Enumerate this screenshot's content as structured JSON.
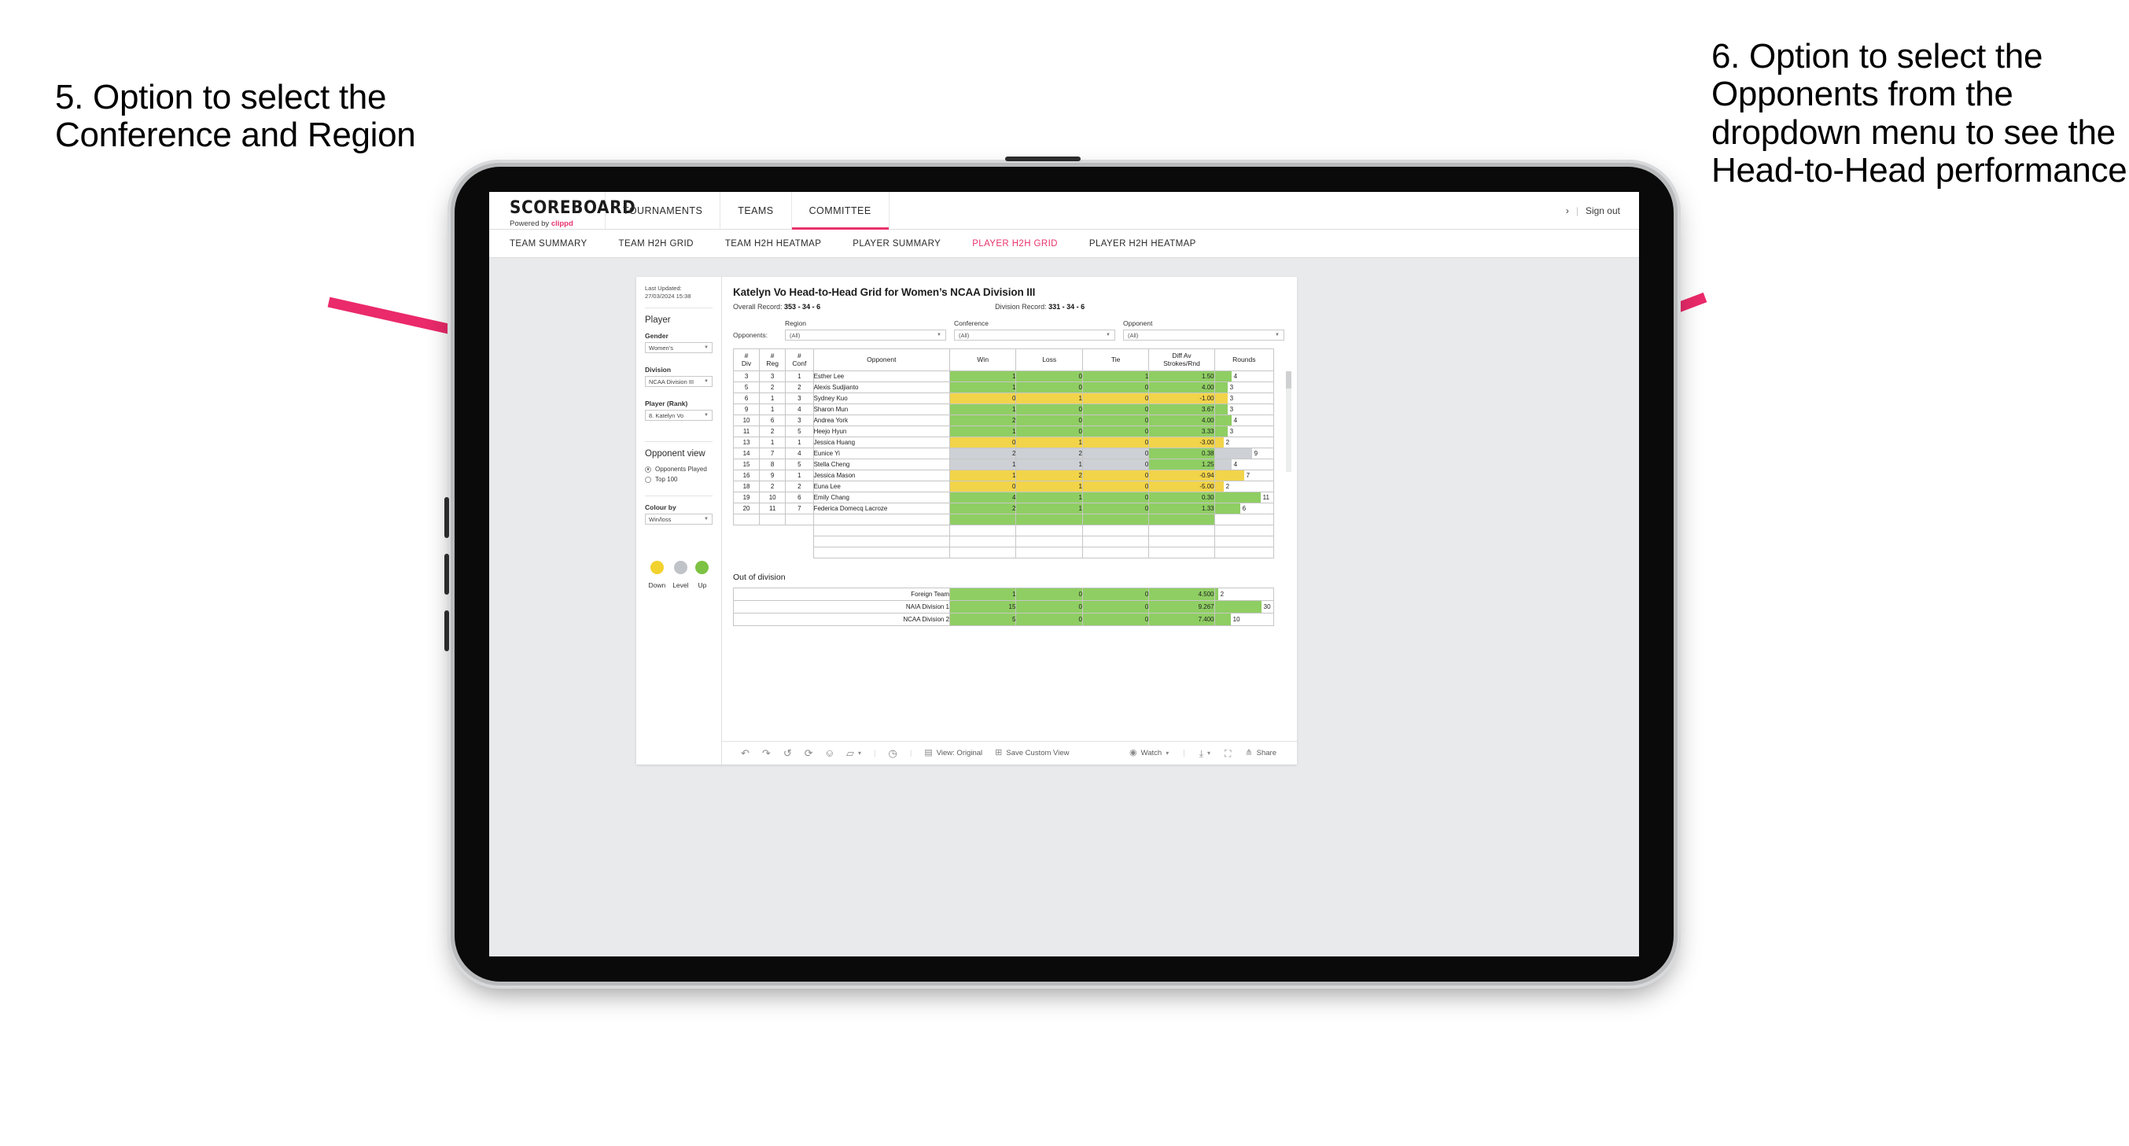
{
  "annotations": {
    "left": "5. Option to select the Conference and Region",
    "right": "6. Option to select the Opponents from the dropdown menu to see the Head-to-Head performance",
    "arrow_color": "#ea2a6a"
  },
  "app": {
    "logo": {
      "word": "SCOREBOARD",
      "powered_prefix": "Powered by ",
      "brand": "clippd"
    },
    "top_nav": [
      {
        "label": "TOURNAMENTS",
        "active": false
      },
      {
        "label": "TEAMS",
        "active": false
      },
      {
        "label": "COMMITTEE",
        "active": true
      }
    ],
    "header_right": {
      "chevron": "›",
      "separator": "|",
      "sign_out": "Sign out"
    },
    "sub_nav": [
      {
        "label": "TEAM SUMMARY",
        "active": false
      },
      {
        "label": "TEAM H2H GRID",
        "active": false
      },
      {
        "label": "TEAM H2H HEATMAP",
        "active": false
      },
      {
        "label": "PLAYER SUMMARY",
        "active": false
      },
      {
        "label": "PLAYER H2H GRID",
        "active": true
      },
      {
        "label": "PLAYER H2H HEATMAP",
        "active": false
      }
    ],
    "accent": "#e8336d"
  },
  "sidebar": {
    "last_updated": "Last Updated: 27/03/2024 15:38",
    "player_heading": "Player",
    "gender": {
      "label": "Gender",
      "value": "Women’s"
    },
    "division": {
      "label": "Division",
      "value": "NCAA Division III"
    },
    "player_rank": {
      "label": "Player (Rank)",
      "value": "8. Katelyn Vo"
    },
    "opponent_view": {
      "heading": "Opponent view",
      "options": [
        {
          "label": "Opponents Played",
          "selected": true
        },
        {
          "label": "Top 100",
          "selected": false
        }
      ]
    },
    "colour_by": {
      "label": "Colour by",
      "value": "Win/loss"
    },
    "legend": [
      {
        "label": "Down",
        "color": "#f2d22e"
      },
      {
        "label": "Level",
        "color": "#c0c3c8"
      },
      {
        "label": "Up",
        "color": "#7dc242"
      }
    ]
  },
  "main": {
    "title": "Katelyn Vo Head-to-Head Grid for Women’s NCAA Division III",
    "overall_record": {
      "label": "Overall Record:",
      "value": "353 -  34 - 6"
    },
    "division_record": {
      "label": "Division Record:",
      "value": "331 -  34 - 6"
    },
    "filters": {
      "prefix": "Opponents:",
      "items": [
        {
          "label": "Region",
          "value": "(All)"
        },
        {
          "label": "Conference",
          "value": "(All)"
        },
        {
          "label": "Opponent",
          "value": "(All)"
        }
      ]
    },
    "out_of_division_title": "Out of division"
  },
  "chart_data": {
    "type": "table",
    "title": "Katelyn Vo Head-to-Head Grid for Women’s NCAA Division III",
    "columns": [
      "# Div",
      "# Reg",
      "# Conf",
      "Opponent",
      "Win",
      "Loss",
      "Tie",
      "Diff Av Strokes/Rnd",
      "Rounds"
    ],
    "column_headers_split": [
      {
        "line1": "#",
        "line2": "Div"
      },
      {
        "line1": "#",
        "line2": "Reg"
      },
      {
        "line1": "#",
        "line2": "Conf"
      },
      {
        "line1": "Opponent",
        "line2": ""
      },
      {
        "line1": "Win",
        "line2": ""
      },
      {
        "line1": "Loss",
        "line2": ""
      },
      {
        "line1": "Tie",
        "line2": ""
      },
      {
        "line1": "Diff Av",
        "line2": "Strokes/Rnd"
      },
      {
        "line1": "Rounds",
        "line2": ""
      }
    ],
    "rounds_max": 12,
    "rows": [
      {
        "div": "3",
        "reg": "3",
        "conf": "1",
        "opponent": "Esther Lee",
        "win": "1",
        "loss": "0",
        "tie": "1",
        "diff": "1.50",
        "rounds": "4",
        "fill": "#8fce63"
      },
      {
        "div": "5",
        "reg": "2",
        "conf": "2",
        "opponent": "Alexis Sudjianto",
        "win": "1",
        "loss": "0",
        "tie": "0",
        "diff": "4.00",
        "rounds": "3",
        "fill": "#8fce63"
      },
      {
        "div": "6",
        "reg": "1",
        "conf": "3",
        "opponent": "Sydney Kuo",
        "win": "0",
        "loss": "1",
        "tie": "0",
        "diff": "-1.00",
        "rounds": "3",
        "fill": "#f2d44a"
      },
      {
        "div": "9",
        "reg": "1",
        "conf": "4",
        "opponent": "Sharon Mun",
        "win": "1",
        "loss": "0",
        "tie": "0",
        "diff": "3.67",
        "rounds": "3",
        "fill": "#8fce63"
      },
      {
        "div": "10",
        "reg": "6",
        "conf": "3",
        "opponent": "Andrea York",
        "win": "2",
        "loss": "0",
        "tie": "0",
        "diff": "4.00",
        "rounds": "4",
        "fill": "#8fce63"
      },
      {
        "div": "11",
        "reg": "2",
        "conf": "5",
        "opponent": "Heejo Hyun",
        "win": "1",
        "loss": "0",
        "tie": "0",
        "diff": "3.33",
        "rounds": "3",
        "fill": "#8fce63"
      },
      {
        "div": "13",
        "reg": "1",
        "conf": "1",
        "opponent": "Jessica Huang",
        "win": "0",
        "loss": "1",
        "tie": "0",
        "diff": "-3.00",
        "rounds": "2",
        "fill": "#f2d44a"
      },
      {
        "div": "14",
        "reg": "7",
        "conf": "4",
        "opponent": "Eunice Yi",
        "win": "2",
        "loss": "2",
        "tie": "0",
        "diff": "0.38",
        "rounds": "9",
        "fill": "#cdd0d4",
        "diff_fill": "#8fce63"
      },
      {
        "div": "15",
        "reg": "8",
        "conf": "5",
        "opponent": "Stella Cheng",
        "win": "1",
        "loss": "1",
        "tie": "0",
        "diff": "1.25",
        "rounds": "4",
        "fill": "#cdd0d4",
        "diff_fill": "#8fce63"
      },
      {
        "div": "16",
        "reg": "9",
        "conf": "1",
        "opponent": "Jessica Mason",
        "win": "1",
        "loss": "2",
        "tie": "0",
        "diff": "-0.94",
        "rounds": "7",
        "fill": "#f2d44a"
      },
      {
        "div": "18",
        "reg": "2",
        "conf": "2",
        "opponent": "Euna Lee",
        "win": "0",
        "loss": "1",
        "tie": "0",
        "diff": "-5.00",
        "rounds": "2",
        "fill": "#f2d44a"
      },
      {
        "div": "19",
        "reg": "10",
        "conf": "6",
        "opponent": "Emily Chang",
        "win": "4",
        "loss": "1",
        "tie": "0",
        "diff": "0.30",
        "rounds": "11",
        "fill": "#8fce63"
      },
      {
        "div": "20",
        "reg": "11",
        "conf": "7",
        "opponent": "Federica Domecq Lacroze",
        "win": "2",
        "loss": "1",
        "tie": "0",
        "diff": "1.33",
        "rounds": "6",
        "fill": "#8fce63"
      }
    ],
    "out_of_division": {
      "rounds_max": 32,
      "rows": [
        {
          "name": "Foreign Team",
          "win": "1",
          "loss": "0",
          "tie": "0",
          "diff": "4.500",
          "rounds": "2",
          "fill": "#8fce63"
        },
        {
          "name": "NAIA Division 1",
          "win": "15",
          "loss": "0",
          "tie": "0",
          "diff": "9.267",
          "rounds": "30",
          "fill": "#8fce63"
        },
        {
          "name": "NCAA Division 2",
          "win": "5",
          "loss": "0",
          "tie": "0",
          "diff": "7.400",
          "rounds": "10",
          "fill": "#8fce63"
        }
      ]
    }
  },
  "toolbar": {
    "view_label": "View: Original",
    "save_label": "Save Custom View",
    "watch_label": "Watch",
    "share_label": "Share",
    "caret": "▾",
    "divider": "|"
  }
}
